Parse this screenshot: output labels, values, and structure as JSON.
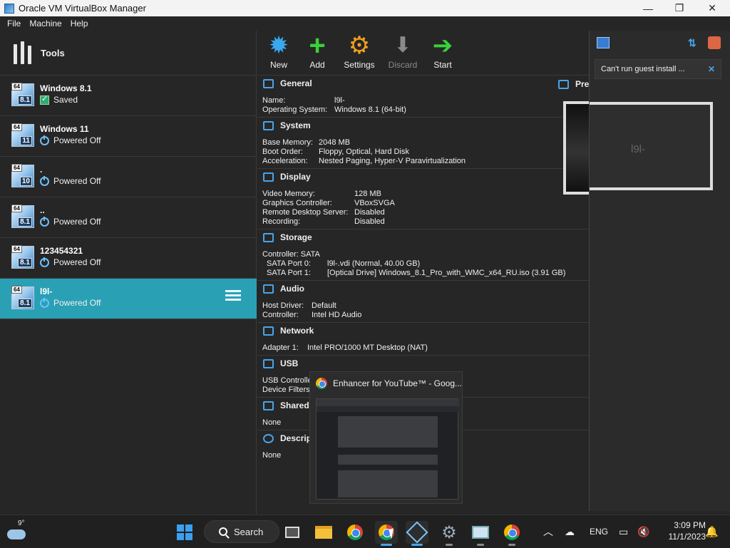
{
  "window": {
    "title": "Oracle VM VirtualBox Manager",
    "minimize": "—",
    "maximize": "❐",
    "close": "✕"
  },
  "menu": {
    "file": "File",
    "machine": "Machine",
    "help": "Help"
  },
  "tools": {
    "label": "Tools"
  },
  "vms": [
    {
      "name": "Windows 8.1",
      "state": "Saved",
      "version": "8.1"
    },
    {
      "name": "Windows 11",
      "state": "Powered Off",
      "version": "11"
    },
    {
      "name": ".",
      "state": "Powered Off",
      "version": "10"
    },
    {
      "name": "..",
      "state": "Powered Off",
      "version": "8.1"
    },
    {
      "name": "123454321",
      "state": "Powered Off",
      "version": "8.1"
    },
    {
      "name": "l9l-",
      "state": "Powered Off",
      "version": "8.1"
    }
  ],
  "toolbar": {
    "new": "New",
    "add": "Add",
    "settings": "Settings",
    "discard": "Discard",
    "start": "Start"
  },
  "details": {
    "general": {
      "title": "General",
      "name_k": "Name:",
      "name_v": "l9l-",
      "os_k": "Operating System:",
      "os_v": "Windows 8.1 (64-bit)"
    },
    "system": {
      "title": "System",
      "mem_k": "Base Memory:",
      "mem_v": "2048 MB",
      "boot_k": "Boot Order:",
      "boot_v": "Floppy, Optical, Hard Disk",
      "accel_k": "Acceleration:",
      "accel_v": "Nested Paging, Hyper-V Paravirtualization"
    },
    "display": {
      "title": "Display",
      "vmem_k": "Video Memory:",
      "vmem_v": "128 MB",
      "gc_k": "Graphics Controller:",
      "gc_v": "VBoxSVGA",
      "rds_k": "Remote Desktop Server:",
      "rds_v": "Disabled",
      "rec_k": "Recording:",
      "rec_v": "Disabled"
    },
    "storage": {
      "title": "Storage",
      "ctrl": "Controller: SATA",
      "p0_k": "SATA Port 0:",
      "p0_v": "l9l-.vdi (Normal, 40.00 GB)",
      "p1_k": "SATA Port 1:",
      "p1_v": "[Optical Drive] Windows_8.1_Pro_with_WMC_x64_RU.iso (3.91 GB)"
    },
    "audio": {
      "title": "Audio",
      "hd_k": "Host Driver:",
      "hd_v": "Default",
      "ctl_k": "Controller:",
      "ctl_v": "Intel HD Audio"
    },
    "network": {
      "title": "Network",
      "a1_k": "Adapter 1:",
      "a1_v": "Intel PRO/1000 MT Desktop (NAT)"
    },
    "usb": {
      "title": "USB",
      "ctrl": "USB Controlle",
      "filters": "Device Filters"
    },
    "shared": {
      "title": "Shared",
      "value": "None"
    },
    "description": {
      "title": "Descrip",
      "value": "None"
    }
  },
  "preview": {
    "title": "Preview",
    "screen_text": "l9l-"
  },
  "notification": {
    "message": "Can't run guest install ..."
  },
  "thumbnail": {
    "title": "Enhancer for YouTube™ - Goog..."
  },
  "taskbar": {
    "temperature": "9°",
    "search": "Search",
    "language": "ENG",
    "time": "3:09 PM",
    "date": "11/1/2023"
  },
  "colors": {
    "selected": "#2aa0b5",
    "accent": "#4aa3e8",
    "bg": "#262626"
  }
}
